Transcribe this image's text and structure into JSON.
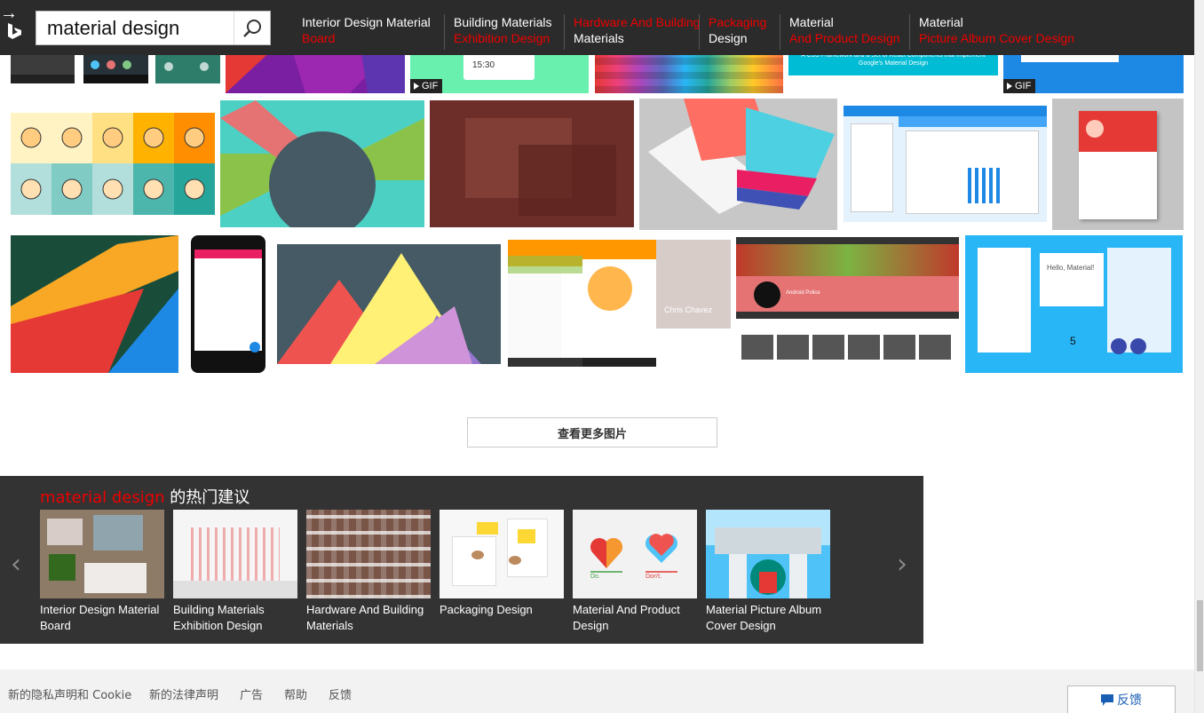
{
  "search": {
    "query": "material design"
  },
  "related": [
    {
      "line1": "Interior Design Material",
      "line2": "Board",
      "line1_color": "white",
      "line2_color": "red"
    },
    {
      "line1": "Building Materials",
      "line2": "Exhibition Design",
      "line1_color": "white",
      "line2_color": "red"
    },
    {
      "line1": "Hardware And Building",
      "line2": "Materials",
      "line1_color": "red",
      "line2_color": "white"
    },
    {
      "line1": "Packaging",
      "line2": "Design",
      "line1_color": "red",
      "line2_color": "white"
    },
    {
      "line1": "Material",
      "line2": "And Product Design",
      "line1_color": "white",
      "line2_color": "red"
    },
    {
      "line1": "Material",
      "line2": "Picture Album Cover Design",
      "line1_color": "white",
      "line2_color": "red"
    }
  ],
  "gallery": {
    "gif_label": "GIF",
    "clock_text": "15:30",
    "css_framework_text": "A CSS Framework and a Set of React Components that Implement Google's Material Design",
    "chris_name": "Chris Chavez",
    "hello_text": "Hello, Material!",
    "number_five": "5",
    "android_police": "Android Police"
  },
  "more_button": "查看更多图片",
  "popular": {
    "title_red": "material design",
    "title_rest": " 的热门建议",
    "items": [
      {
        "label": "Interior Design Material Board"
      },
      {
        "label": "Building Materials Exhibition Design"
      },
      {
        "label": "Hardware And Building Materials"
      },
      {
        "label": "Packaging Design"
      },
      {
        "label": "Material And Product Design"
      },
      {
        "label": "Material Picture Album Cover Design"
      }
    ],
    "material_do": "Do.",
    "material_dont": "Don't."
  },
  "footer": {
    "privacy": "新的隐私声明和 Cookie",
    "legal": "新的法律声明",
    "ads": "广告",
    "help": "帮助",
    "feedback": "反馈"
  },
  "feedback_button": "反馈",
  "colors": {
    "topbar": "#2b2b2b",
    "accent_red": "#ee0000",
    "popular_bg": "#333333",
    "footer_bg": "#f2f2f2",
    "link_blue": "#1a5fb4"
  }
}
